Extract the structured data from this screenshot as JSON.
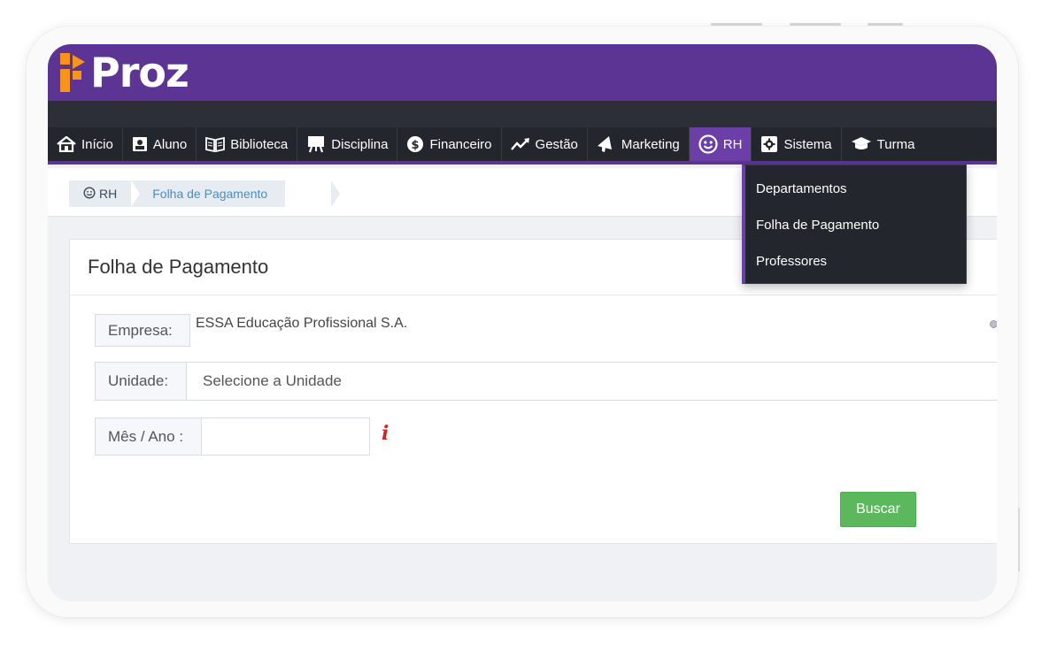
{
  "brand": {
    "name": "Proz",
    "primary_color": "#5c3494",
    "nav_bg": "#24262d"
  },
  "menu": [
    {
      "label": "Início",
      "icon": "home-icon"
    },
    {
      "label": "Aluno",
      "icon": "id-card-icon"
    },
    {
      "label": "Biblioteca",
      "icon": "book-icon"
    },
    {
      "label": "Disciplina",
      "icon": "easel-icon"
    },
    {
      "label": "Financeiro",
      "icon": "dollar-circle-icon"
    },
    {
      "label": "Gestão",
      "icon": "trend-icon"
    },
    {
      "label": "Marketing",
      "icon": "megaphone-icon"
    },
    {
      "label": "RH",
      "icon": "smiley-icon",
      "active": true
    },
    {
      "label": "Sistema",
      "icon": "gear-icon"
    },
    {
      "label": "Turma",
      "icon": "graduation-cap-icon"
    }
  ],
  "rh_dropdown": {
    "items": [
      "Departamentos",
      "Folha de Pagamento",
      "Professores"
    ]
  },
  "breadcrumb": {
    "root": "RH",
    "current": "Folha de Pagamento"
  },
  "panel": {
    "title": "Folha de Pagamento",
    "empresa_label": "Empresa:",
    "empresa_value": "ESSA Educação Profissional S.A.",
    "unidade_label": "Unidade:",
    "unidade_value": "Selecione a Unidade",
    "mes_ano_label": "Mês / Ano :",
    "mes_ano_value": "",
    "info_mark": "i",
    "buscar_label": "Buscar",
    "buscar_color": "#5cb85c"
  }
}
